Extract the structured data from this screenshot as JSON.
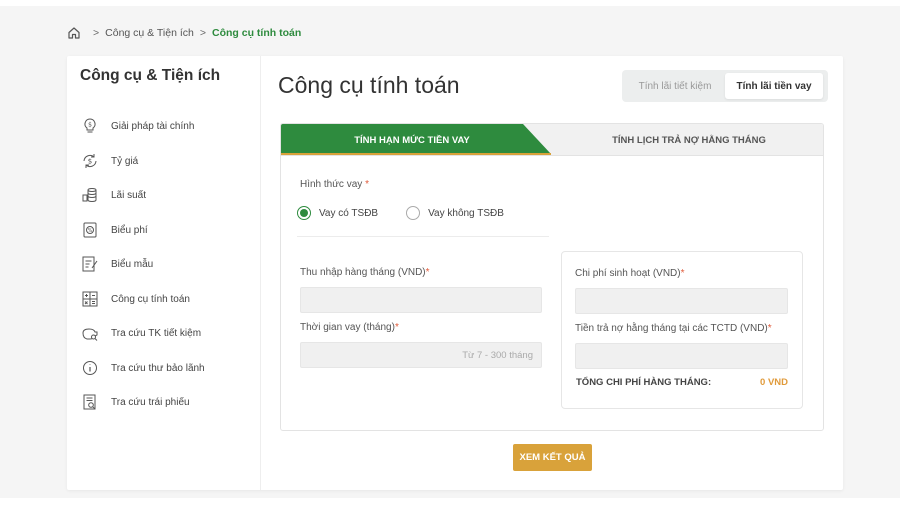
{
  "breadcrumb": {
    "home_icon": "home-icon",
    "separator": ">",
    "item1": "Công cụ & Tiện ích",
    "current": "Công cụ tính toán"
  },
  "sidebar": {
    "title": "Công cụ & Tiện ích",
    "items": [
      {
        "label": "Giải pháp tài chính",
        "icon": "lightbulb-dollar-icon"
      },
      {
        "label": "Tỷ giá",
        "icon": "exchange-dollar-icon"
      },
      {
        "label": "Lãi suất",
        "icon": "coins-stack-icon"
      },
      {
        "label": "Biểu phí",
        "icon": "fee-document-icon"
      },
      {
        "label": "Biểu mẫu",
        "icon": "form-edit-icon"
      },
      {
        "label": "Công cụ tính toán",
        "icon": "calculator-icon"
      },
      {
        "label": "Tra cứu TK tiết kiệm",
        "icon": "piggy-bank-search-icon"
      },
      {
        "label": "Tra cứu thư bảo lãnh",
        "icon": "info-circle-icon"
      },
      {
        "label": "Tra cứu trái phiếu",
        "icon": "document-search-icon"
      }
    ]
  },
  "main": {
    "title": "Công cụ tính toán",
    "toggle": {
      "option1": "Tính lãi tiết kiệm",
      "option2": "Tính lãi tiền vay",
      "selected": "option2"
    },
    "tabs": {
      "tab1": "TÍNH HẠN MỨC TIỀN VAY",
      "tab2": "TÍNH LỊCH TRẢ NỢ HẰNG THÁNG"
    },
    "form": {
      "loan_type_label": "Hình thức vay",
      "required_mark": "*",
      "radio1": "Vay có TSĐB",
      "radio2": "Vay không TSĐB",
      "income_label": "Thu nhập hàng tháng (VND)",
      "term_label": "Thời gian vay (tháng)",
      "term_placeholder": "Từ 7 - 300 tháng",
      "living_cost_label": "Chi phí sinh hoạt (VND)",
      "debt_payment_label": "Tiền trả nợ hằng tháng tại các TCTD (VND)",
      "total_label": "TỔNG CHI PHÍ HÀNG THÁNG:",
      "total_value": "0 VND"
    },
    "submit_button": "XEM KẾT QUẢ"
  },
  "colors": {
    "brand_green": "#2e8b3e",
    "accent_gold": "#d9a23a",
    "total_orange": "#e09a3a"
  }
}
